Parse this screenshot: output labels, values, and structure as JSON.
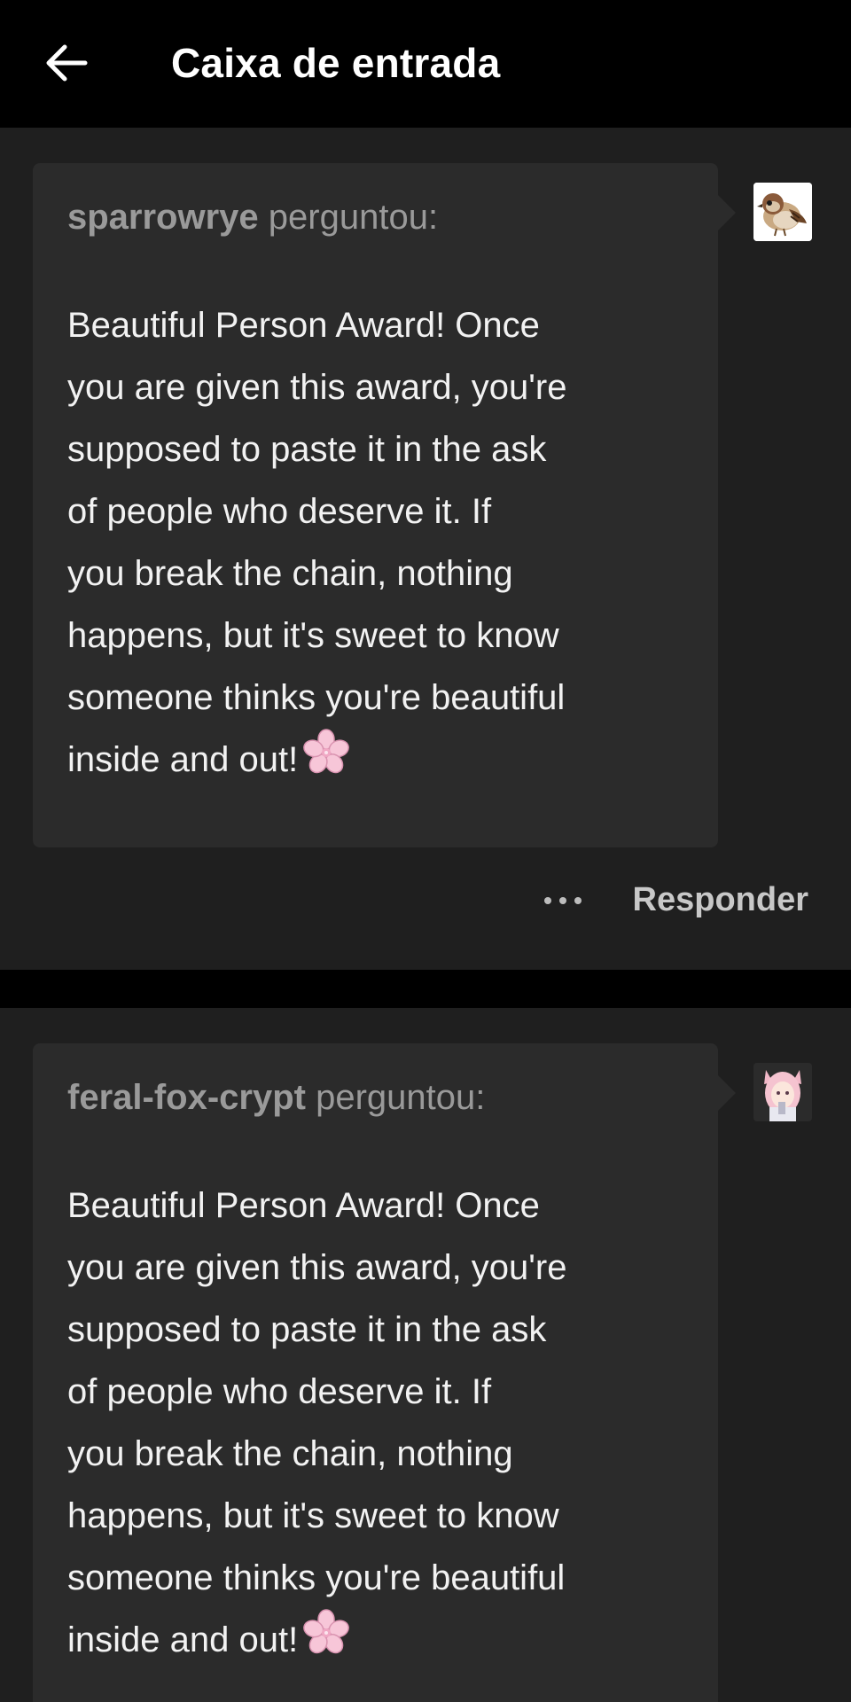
{
  "header": {
    "title": "Caixa de entrada"
  },
  "asks": [
    {
      "asker": "sparrowrye",
      "verb": "perguntou:",
      "avatar_icon": "sparrow-avatar",
      "lines": [
        "Beautiful Person Award! Once",
        "you are given this award, you're",
        "supposed to paste it in the ask",
        "of people who deserve it. If",
        "you break the chain, nothing",
        "happens, but it's sweet to know",
        "someone thinks you're beautiful",
        "inside and out!"
      ],
      "emoji_icon": "cherry-blossom-icon",
      "more_label": "more-options",
      "reply_label": "Responder"
    },
    {
      "asker": "feral-fox-crypt",
      "verb": "perguntou:",
      "avatar_icon": "anime-girl-avatar",
      "lines": [
        "Beautiful Person Award! Once",
        "you are given this award, you're",
        "supposed to paste it in the ask",
        "of people who deserve it. If",
        "you break the chain, nothing",
        "happens, but it's sweet to know",
        "someone thinks you're beautiful",
        "inside and out!"
      ],
      "emoji_icon": "cherry-blossom-icon"
    }
  ],
  "colors": {
    "background": "#000000",
    "card": "#1f1f1f",
    "bubble": "#2b2b2b",
    "text": "#f2f2f2",
    "muted": "#9a9a9a",
    "action": "#c8c8c8"
  }
}
